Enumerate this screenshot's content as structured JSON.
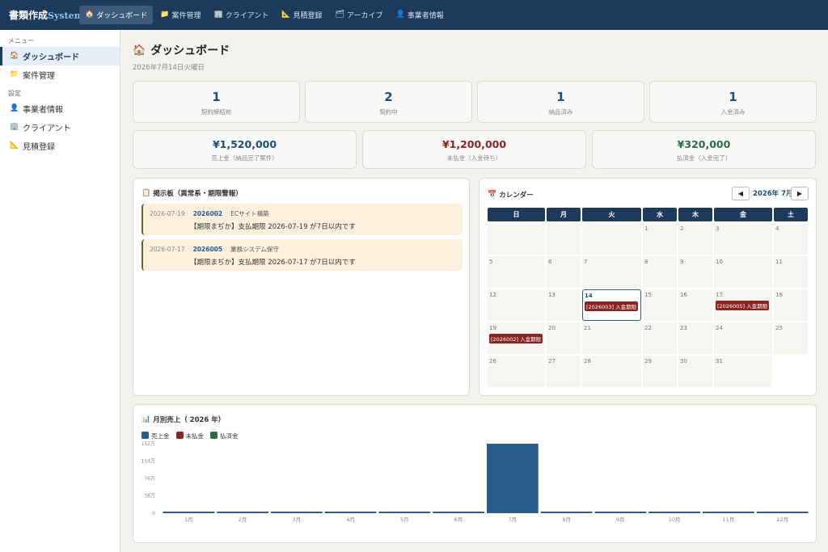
{
  "app": {
    "brand_main": "書類作成",
    "brand_sub": "System"
  },
  "nav": [
    {
      "icon": "house-icon",
      "glyph": "🏠",
      "label": "ダッシュボード",
      "active": true
    },
    {
      "icon": "folder-icon",
      "glyph": "📁",
      "label": "案件管理"
    },
    {
      "icon": "building-icon",
      "glyph": "🏢",
      "label": "クライアント"
    },
    {
      "icon": "ruler-icon",
      "glyph": "📐",
      "label": "見積登録"
    },
    {
      "icon": "archive-icon",
      "glyph": "🗂",
      "label": "アーカイブ"
    },
    {
      "icon": "person-icon",
      "glyph": "👤",
      "label": "事業者情報"
    }
  ],
  "sidebar": {
    "menu_heading": "メニュー",
    "menu_items": [
      {
        "icon": "house-icon",
        "glyph": "🏠",
        "label": "ダッシュボード",
        "active": true
      },
      {
        "icon": "folder-icon",
        "glyph": "📁",
        "label": "案件管理"
      }
    ],
    "settings_heading": "設定",
    "settings_items": [
      {
        "icon": "person-icon",
        "glyph": "👤",
        "label": "事業者情報"
      },
      {
        "icon": "building-icon",
        "glyph": "🏢",
        "label": "クライアント"
      },
      {
        "icon": "ruler-icon",
        "glyph": "📐",
        "label": "見積登録"
      }
    ]
  },
  "page": {
    "title_glyph": "🏠",
    "title": "ダッシュボード",
    "date": "2026年7月14日火曜日"
  },
  "stats": [
    {
      "value": "1",
      "label": "契約締結前"
    },
    {
      "value": "2",
      "label": "契約中"
    },
    {
      "value": "1",
      "label": "納品済み"
    },
    {
      "value": "1",
      "label": "入金済み"
    }
  ],
  "money": [
    {
      "value": "¥1,520,000",
      "label": "売上金（納品完了案件）",
      "color": "blue"
    },
    {
      "value": "¥1,200,000",
      "label": "未払金（入金待ち）",
      "color": "red"
    },
    {
      "value": "¥320,000",
      "label": "払済金（入金完了）",
      "color": "green"
    }
  ],
  "board": {
    "glyph": "📋",
    "title": "掲示板（異常系・期限警報）",
    "notices": [
      {
        "date": "2026-07-19",
        "code": "2026002",
        "client": "ECサイト構築",
        "message": "【期限まぢか】支払期限 2026-07-19 が7日以内です"
      },
      {
        "date": "2026-07-17",
        "code": "2026005",
        "client": "業務システム保守",
        "message": "【期限まぢか】支払期限 2026-07-17 が7日以内です"
      }
    ]
  },
  "calendar": {
    "glyph": "📅",
    "title": "カレンダー",
    "month_label": "2026年 7月",
    "prev": "◀",
    "next": "▶",
    "weekdays": [
      "日",
      "月",
      "火",
      "水",
      "木",
      "金",
      "土"
    ],
    "start_weekday": 3,
    "days_in_month": 31,
    "today": 14,
    "events": [
      {
        "day": 14,
        "label": "[2026003] 入金期限"
      },
      {
        "day": 17,
        "label": "[2026005] 入金期限"
      },
      {
        "day": 19,
        "label": "[2026002] 入金期限"
      }
    ]
  },
  "chart_section": {
    "glyph": "📊",
    "title": "月別売上（  2026  年）",
    "legend": [
      {
        "label": "売上金",
        "color": "#2c5c8a"
      },
      {
        "label": "未払金",
        "color": "#8b2420"
      },
      {
        "label": "払済金",
        "color": "#2c6b4a"
      }
    ]
  },
  "chart_data": {
    "type": "bar",
    "categories": [
      "1月",
      "2月",
      "3月",
      "4月",
      "5月",
      "6月",
      "7月",
      "8月",
      "9月",
      "10月",
      "11月",
      "12月"
    ],
    "series": [
      {
        "name": "売上金",
        "values": [
          0,
          0,
          0,
          0,
          0,
          0,
          1520000,
          0,
          0,
          0,
          0,
          0
        ],
        "color": "#2c5c8a"
      }
    ],
    "yticks": [
      0,
      380000,
      760000,
      1140000,
      1520000
    ],
    "ytick_labels": [
      "0",
      "38万",
      "76万",
      "114万",
      "152万"
    ],
    "ylim": [
      0,
      1520000
    ]
  }
}
